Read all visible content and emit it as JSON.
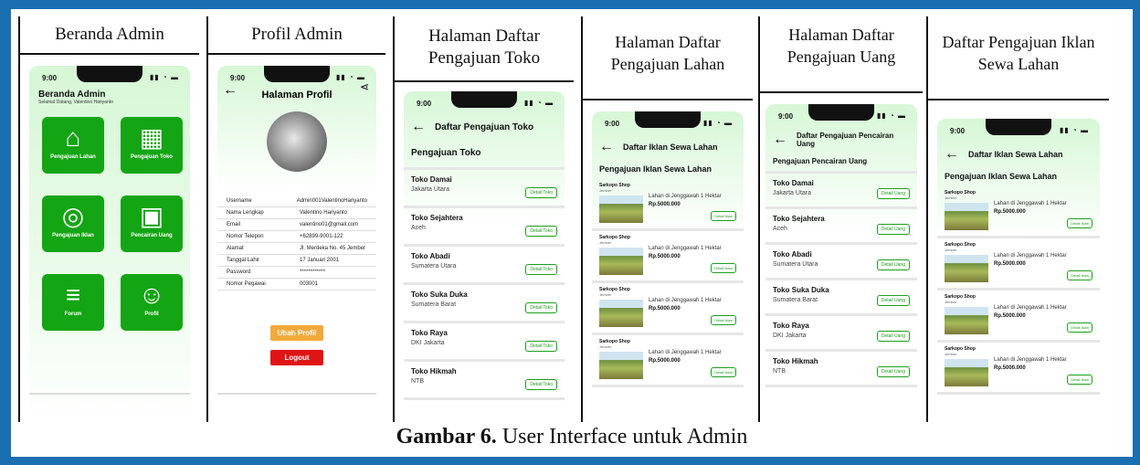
{
  "caption": {
    "label": "Gambar 6.",
    "text": " User Interface untuk Admin"
  },
  "status_time": "9:00",
  "columns": {
    "beranda": {
      "title": "Beranda Admin",
      "app_title": "Beranda Admin",
      "greeting": "Selamat Datang, Valentino Hariyanto",
      "tiles": [
        {
          "label": "Pengajuan Lahan",
          "icon": "land-icon"
        },
        {
          "label": "Pengajuan Toko",
          "icon": "store-icon"
        },
        {
          "label": "Pengajuan Iklan",
          "icon": "ad-click-icon"
        },
        {
          "label": "Pencairan Uang",
          "icon": "money-icon"
        },
        {
          "label": "Forum",
          "icon": "forum-icon"
        },
        {
          "label": "Profil",
          "icon": "profile-icon"
        }
      ]
    },
    "profil": {
      "title": "Profil Admin",
      "page_title": "Halaman Profil",
      "fields": [
        {
          "k": "Username",
          "v": "Admin001ValentinoHariyanto"
        },
        {
          "k": "Nama Lengkap",
          "v": "Valentino Hariyanto"
        },
        {
          "k": "Email",
          "v": "valentino01@gmail.com"
        },
        {
          "k": "Nomor Telepon",
          "v": "+62899-9001-122"
        },
        {
          "k": "Alamat",
          "v": "Jl. Merdeka No. 45 Jember"
        },
        {
          "k": "Tanggal Lahir",
          "v": "17 Januari 2001"
        },
        {
          "k": "Password",
          "v": "************"
        },
        {
          "k": "Nomor Pegawai",
          "v": "003001"
        }
      ],
      "edit_label": "Ubah Profil",
      "logout_label": "Logout"
    },
    "toko": {
      "title": "Halaman Daftar Pengajuan Toko",
      "header": "Daftar Pengajuan Toko",
      "section": "Pengajuan Toko",
      "button": "Detail Toko",
      "items": [
        {
          "name": "Toko Damai",
          "loc": "Jakarta Utara"
        },
        {
          "name": "Toko Sejahtera",
          "loc": "Aceh"
        },
        {
          "name": "Toko Abadi",
          "loc": "Sumatera Utara"
        },
        {
          "name": "Toko Suka Duka",
          "loc": "Sumatera Barat"
        },
        {
          "name": "Toko Raya",
          "loc": "DKI Jakarta"
        },
        {
          "name": "Toko Hikmah",
          "loc": "NTB"
        }
      ]
    },
    "lahan": {
      "title": "Halaman Daftar Pengajuan Lahan",
      "header": "Daftar Iklan Sewa Lahan",
      "section": "Pengajuan Iklan Sewa Lahan",
      "shop": "Sarkopo Shop",
      "shop_loc": "Jember",
      "ad_text": "Lahan di Jenggawah 1 Hektar",
      "price": "Rp.5000.000",
      "button": "Detail Iklan"
    },
    "uang": {
      "title": "Halaman Daftar Pengajuan Uang",
      "header": "Daftar Pengajuan Pencairan Uang",
      "section": "Pengajuan Pencairan Uang",
      "button": "Detail Uang",
      "items": [
        {
          "name": "Toko Damai",
          "loc": "Jakarta Utara"
        },
        {
          "name": "Toko Sejahtera",
          "loc": "Aceh"
        },
        {
          "name": "Toko Abadi",
          "loc": "Sumatera Utara"
        },
        {
          "name": "Toko Suka Duka",
          "loc": "Sumatera Barat"
        },
        {
          "name": "Toko Raya",
          "loc": "DKI Jakarta"
        },
        {
          "name": "Toko Hikmah",
          "loc": "NTB"
        }
      ]
    },
    "iklan": {
      "title": "Daftar Pengajuan Iklan Sewa Lahan",
      "header": "Daftar Iklan Sewa Lahan",
      "section": "Pengajuan Iklan Sewa Lahan",
      "shop": "Sarkopo Shop",
      "shop_loc": "Jember",
      "ad_text": "Lahan di Jenggawah 1 Hektar",
      "price": "Rp.5000.000",
      "button": "Detail Iklan"
    }
  }
}
